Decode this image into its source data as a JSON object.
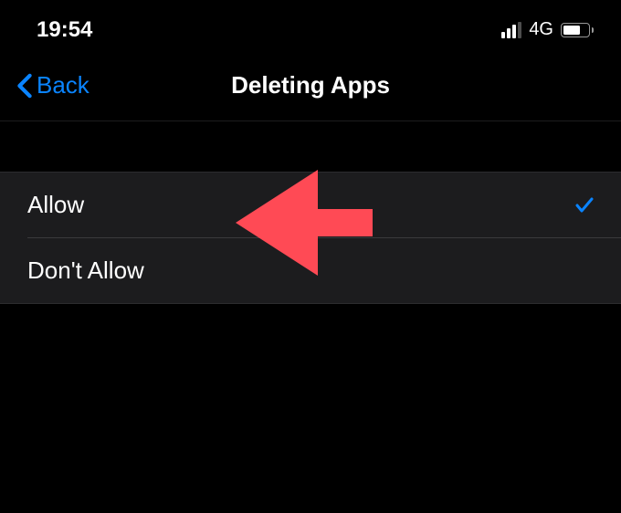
{
  "statusBar": {
    "time": "19:54",
    "networkLabel": "4G"
  },
  "navBar": {
    "backLabel": "Back",
    "title": "Deleting Apps"
  },
  "options": {
    "allow": {
      "label": "Allow",
      "selected": true
    },
    "dontAllow": {
      "label": "Don't Allow",
      "selected": false
    }
  },
  "colors": {
    "accent": "#0a84ff",
    "annotation": "#ff4a55"
  }
}
